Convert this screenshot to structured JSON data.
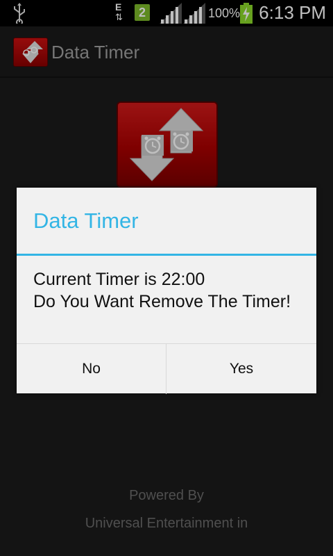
{
  "status_bar": {
    "network_type": "E",
    "notification_count": "2",
    "battery_percent": "100%",
    "time": "6:13 PM",
    "icons": [
      "usb-icon",
      "data-arrows-icon",
      "notification-badge-icon",
      "signal-icon",
      "signal-icon-2",
      "battery-charging-icon"
    ]
  },
  "action_bar": {
    "title": "Data Timer",
    "icon": "data-timer-app-icon"
  },
  "dialog": {
    "title": "Data Timer",
    "message_line1": "Current Timer is 22:00",
    "message_line2": "Do You Want Remove The Timer!",
    "no_label": "No",
    "yes_label": "Yes"
  },
  "footer": {
    "line1": "Powered By",
    "line2": "Universal Entertainment in"
  },
  "colors": {
    "accent": "#33b5e5",
    "icon_red": "#c81010",
    "background": "#1b1b1b"
  }
}
